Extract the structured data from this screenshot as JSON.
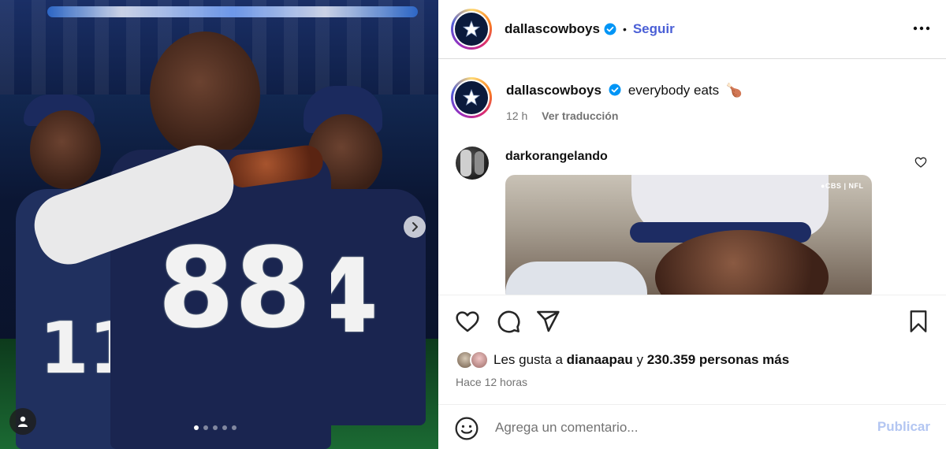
{
  "post": {
    "account": {
      "username": "dallascowboys",
      "verified": true,
      "follow_label": "Seguir",
      "separator": "•"
    },
    "caption": {
      "username": "dallascowboys",
      "text": "everybody eats",
      "emoji": "🍗",
      "time": "12 h",
      "translate_label": "Ver traducción"
    },
    "comment": {
      "username": "darkorangelando",
      "gif_badge": "●CBS | NFL"
    },
    "media": {
      "jersey_numbers": [
        "88",
        "4",
        "11"
      ],
      "carousel_count": 5,
      "carousel_active_index": 0
    },
    "likes": {
      "prefix": "Les gusta a",
      "first_user": "dianaapau",
      "connector": "y",
      "others": "230.359 personas más"
    },
    "time_ago": "Hace 12 horas",
    "composer": {
      "placeholder": "Agrega un comentario...",
      "publish_label": "Publicar"
    }
  },
  "colors": {
    "link_blue": "#4a5fd6",
    "publish_disabled": "#b3c6f2",
    "muted": "#737373",
    "verified_blue": "#0095f6"
  },
  "icons": [
    "star-logo-icon",
    "verified-icon",
    "more-icon",
    "heart-icon",
    "comment-icon",
    "share-icon",
    "save-icon",
    "emoji-icon",
    "chevron-right-icon",
    "user-tag-icon"
  ]
}
